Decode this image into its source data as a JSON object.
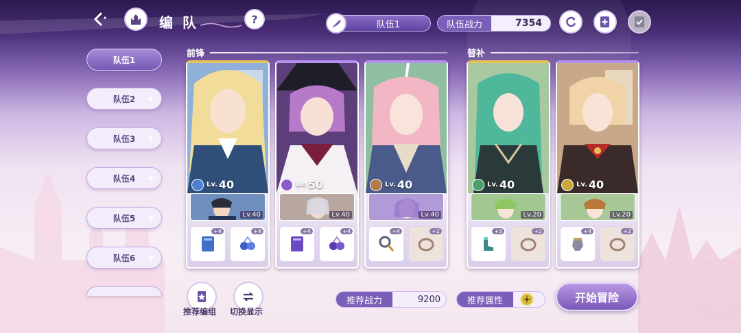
{
  "header": {
    "title": "编队",
    "team_selected": "队伍1",
    "power_label": "队伍战力",
    "power_value": "7354"
  },
  "sidebar": {
    "items": [
      {
        "label": "队伍1",
        "active": true
      },
      {
        "label": "队伍2",
        "active": false
      },
      {
        "label": "队伍3",
        "active": false
      },
      {
        "label": "队伍4",
        "active": false
      },
      {
        "label": "队伍5",
        "active": false
      },
      {
        "label": "队伍6",
        "active": false
      }
    ]
  },
  "sections": {
    "front": "前锋",
    "bench": "替补"
  },
  "cards": [
    {
      "level_prefix": "Lv.",
      "level": "40",
      "sub_level": "Lv.40",
      "equip_plus": [
        "+4",
        "+4"
      ],
      "attr_color": "#4f7fd0"
    },
    {
      "level_prefix": "Lv.",
      "level": "50",
      "sub_level": "Lv.40",
      "equip_plus": [
        "+4",
        "+4"
      ],
      "attr_color": "#8a5ec8"
    },
    {
      "level_prefix": "Lv.",
      "level": "40",
      "sub_level": "Lv.40",
      "equip_plus": [
        "+4",
        "+2"
      ],
      "attr_color": "#b07a4a"
    },
    {
      "level_prefix": "Lv.",
      "level": "40",
      "sub_level": "Lv.20",
      "equip_plus": [
        "+3",
        "+2"
      ],
      "attr_color": "#4aa06a"
    },
    {
      "level_prefix": "Lv.",
      "level": "40",
      "sub_level": "Lv.20",
      "equip_plus": [
        "+4",
        "+2"
      ],
      "attr_color": "#c8a83a"
    }
  ],
  "bottom": {
    "recommend_team": "推荐编组",
    "toggle_display": "切换显示",
    "recommend_power_label": "推荐战力",
    "recommend_power_value": "9200",
    "recommend_attr_label": "推荐属性",
    "start_label": "开始冒险"
  },
  "colors": {
    "accent": "#7458b4",
    "gold": "#e6c25a"
  },
  "icons": [
    "back-icon",
    "castle-icon",
    "help-icon",
    "feather-icon",
    "refresh-icon",
    "add-document-icon",
    "checklist-icon",
    "star-icon",
    "swap-icon",
    "light-attr-icon"
  ]
}
